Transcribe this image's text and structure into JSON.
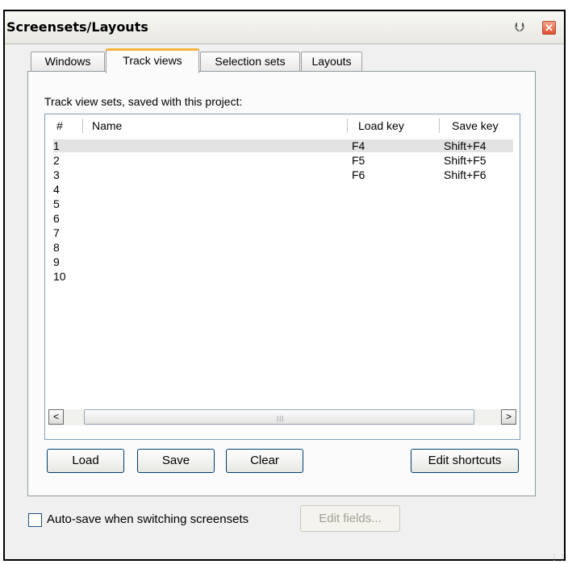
{
  "window": {
    "title": "Screensets/Layouts",
    "pin_glyph": "⮋",
    "close_glyph": "✕"
  },
  "tabs": [
    {
      "label": "Windows",
      "active": false
    },
    {
      "label": "Track views",
      "active": true
    },
    {
      "label": "Selection sets",
      "active": false
    },
    {
      "label": "Layouts",
      "active": false
    }
  ],
  "panel": {
    "label": "Track view sets, saved with this project:",
    "columns": {
      "num": "#",
      "name": "Name",
      "load": "Load key",
      "save": "Save key"
    },
    "rows": [
      {
        "num": "1",
        "name": "",
        "load": "F4",
        "save": "Shift+F4",
        "selected": true
      },
      {
        "num": "2",
        "name": "",
        "load": "F5",
        "save": "Shift+F5"
      },
      {
        "num": "3",
        "name": "",
        "load": "F6",
        "save": "Shift+F6"
      },
      {
        "num": "4",
        "name": "",
        "load": "",
        "save": ""
      },
      {
        "num": "5",
        "name": "",
        "load": "",
        "save": ""
      },
      {
        "num": "6",
        "name": "",
        "load": "",
        "save": ""
      },
      {
        "num": "7",
        "name": "",
        "load": "",
        "save": ""
      },
      {
        "num": "8",
        "name": "",
        "load": "",
        "save": ""
      },
      {
        "num": "9",
        "name": "",
        "load": "",
        "save": ""
      },
      {
        "num": "10",
        "name": "",
        "load": "",
        "save": ""
      }
    ],
    "scroll_left": "<",
    "scroll_right": ">",
    "scroll_grip": "|||"
  },
  "buttons": {
    "load": "Load",
    "save": "Save",
    "clear": "Clear",
    "edit_shortcuts": "Edit shortcuts"
  },
  "footer": {
    "autosave_label": "Auto-save when switching screensets",
    "autosave_checked": false,
    "edit_fields": "Edit fields..."
  }
}
